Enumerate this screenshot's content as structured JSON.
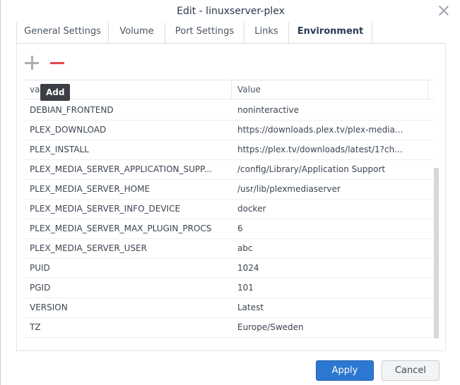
{
  "window": {
    "title": "Edit - linuxserver-plex"
  },
  "tabs": [
    {
      "label": "General Settings",
      "active": false
    },
    {
      "label": "Volume",
      "active": false
    },
    {
      "label": "Port Settings",
      "active": false
    },
    {
      "label": "Links",
      "active": false
    },
    {
      "label": "Environment",
      "active": true
    }
  ],
  "toolbar": {
    "add_icon": "plus-icon",
    "remove_icon": "minus-icon",
    "tooltip": "Add"
  },
  "table": {
    "columns": [
      "variable",
      "Value"
    ],
    "rows": [
      {
        "name": "DEBIAN_FRONTEND",
        "value": "noninteractive"
      },
      {
        "name": "PLEX_DOWNLOAD",
        "value": "https://downloads.plex.tv/plex-media..."
      },
      {
        "name": "PLEX_INSTALL",
        "value": "https://plex.tv/downloads/latest/1?ch..."
      },
      {
        "name": "PLEX_MEDIA_SERVER_APPLICATION_SUPP...",
        "value": "/config/Library/Application Support"
      },
      {
        "name": "PLEX_MEDIA_SERVER_HOME",
        "value": "/usr/lib/plexmediaserver"
      },
      {
        "name": "PLEX_MEDIA_SERVER_INFO_DEVICE",
        "value": "docker"
      },
      {
        "name": "PLEX_MEDIA_SERVER_MAX_PLUGIN_PROCS",
        "value": "6"
      },
      {
        "name": "PLEX_MEDIA_SERVER_USER",
        "value": "abc"
      },
      {
        "name": "PUID",
        "value": "1024"
      },
      {
        "name": "PGID",
        "value": "101"
      },
      {
        "name": "VERSION",
        "value": "Latest"
      },
      {
        "name": "TZ",
        "value": "Europe/Sweden"
      }
    ]
  },
  "footer": {
    "apply_label": "Apply",
    "cancel_label": "Cancel"
  },
  "colors": {
    "primary": "#2d78d0",
    "remove": "#e5474b",
    "tooltip_bg": "#3b3f45"
  }
}
